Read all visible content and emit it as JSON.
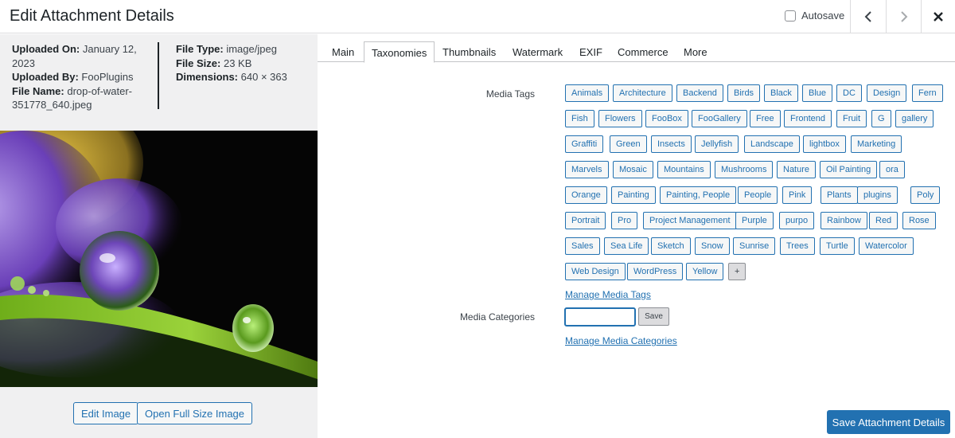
{
  "header": {
    "title": "Edit Attachment Details",
    "autosave_label": "Autosave",
    "autosave_checked": false
  },
  "meta": {
    "uploaded_on_label": "Uploaded On:",
    "uploaded_on": "January 12, 2023",
    "uploaded_by_label": "Uploaded By:",
    "uploaded_by": "FooPlugins",
    "file_name_label": "File Name:",
    "file_name_1": "drop-of-water-",
    "file_name_2": "351778_640.jpeg",
    "file_type_label": "File Type:",
    "file_type": "image/jpeg",
    "file_size_label": "File Size:",
    "file_size": "23 KB",
    "dimensions_label": "Dimensions:",
    "dimensions": "640 × 363"
  },
  "actions": {
    "edit_image": "Edit Image",
    "open_full": "Open Full Size Image",
    "save_details": "Save Attachment Details"
  },
  "tabs": [
    "Main",
    "Taxonomies",
    "Thumbnails",
    "Watermark",
    "EXIF",
    "Commerce",
    "More"
  ],
  "active_tab": "Taxonomies",
  "media_tags": {
    "label": "Media Tags",
    "tags": [
      "Animals",
      "Architecture",
      "Backend",
      "Birds",
      "Black",
      "Blue",
      "DC",
      "Design",
      "Fern",
      "Fish",
      "Flowers",
      "FooBox",
      "FooGallery",
      "Free",
      "Frontend",
      "Fruit",
      "G",
      "gallery",
      "Graffiti",
      "Green",
      "Insects",
      "Jellyfish",
      "Landscape",
      "lightbox",
      "Marketing",
      "Marvels",
      "Mosaic",
      "Mountains",
      "Mushrooms",
      "Nature",
      "Oil Painting",
      "ora",
      "Orange",
      "Painting",
      "Painting, People",
      "People",
      "Pink",
      "Plants",
      "plugins",
      "Poly",
      "Portrait",
      "Pro",
      "Project Management",
      "Purple",
      "purpo",
      "Rainbow",
      "Red",
      "Rose",
      "Sales",
      "Sea Life",
      "Sketch",
      "Snow",
      "Sunrise",
      "Trees",
      "Turtle",
      "Watercolor",
      "Web Design",
      "WordPress",
      "Yellow"
    ],
    "add_label": "+",
    "manage_link": "Manage Media Tags"
  },
  "media_categories": {
    "label": "Media Categories",
    "input_value": "",
    "save_label": "Save",
    "manage_link": "Manage Media Categories"
  },
  "colors": {
    "accent": "#2271b1",
    "panel_bg": "#f0f0f1",
    "border": "#dcdcde"
  },
  "icons": {
    "prev": "chevron-left-icon",
    "next": "chevron-right-icon",
    "close": "close-icon"
  }
}
